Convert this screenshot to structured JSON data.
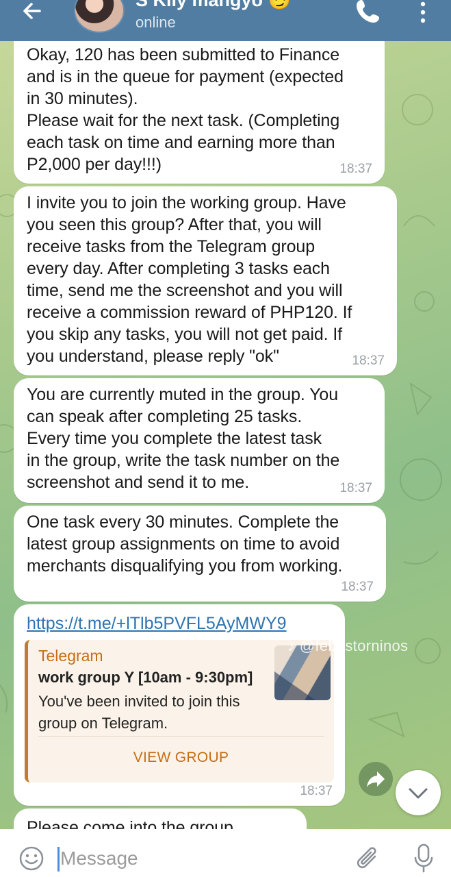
{
  "header": {
    "title": "S Kily mangyo 😏",
    "status": "online"
  },
  "messages": [
    {
      "text": "Okay, 120 has been submitted to Finance\nand is in the queue for payment (expected\nin 30 minutes).\nPlease wait for the next task. (Completing\neach task on time and earning more than\nP2,000 per day!!!)",
      "time": "18:37"
    },
    {
      "text": "I invite you to join the working group. Have\nyou seen this group? After that, you will\nreceive tasks from the Telegram group\nevery day. After completing 3 tasks each\ntime, send me the screenshot and you will\nreceive a commission reward of PHP120. If\nyou skip any tasks, you will not get paid. If\nyou understand, please reply \"ok\"",
      "time": "18:37"
    },
    {
      "text": "You are currently muted in the group. You\ncan speak after completing 25 tasks.\nEvery time you complete the latest task\nin the group, write the task number on the\nscreenshot and send it to me.",
      "time": "18:37"
    },
    {
      "text": "One task every 30 minutes. Complete the\nlatest group assignments on time to avoid\nmerchants disqualifying you from working.",
      "time": "18:37"
    },
    {
      "link": "https://t.me/+lTlb5PVFL5AyMWY9",
      "preview": {
        "site": "Telegram",
        "title": "work group Y [10am - 9:30pm]",
        "description": "You've been invited to join this\ngroup on Telegram.",
        "action": "VIEW GROUP"
      },
      "time": "18:37"
    },
    {
      "text": "Please come into the group"
    }
  ],
  "watermark": {
    "logo": "♪",
    "handle": "@febestorninos"
  },
  "input": {
    "placeholder": "Message"
  },
  "colors": {
    "header": "#517da2",
    "link": "#2f73b0",
    "preview_accent": "#c56d16",
    "bubble": "#ffffff"
  },
  "icons": [
    "back-arrow-icon",
    "phone-icon",
    "more-vertical-icon",
    "forward-icon",
    "chevron-down-icon",
    "emoji-icon",
    "paperclip-icon",
    "microphone-icon"
  ]
}
